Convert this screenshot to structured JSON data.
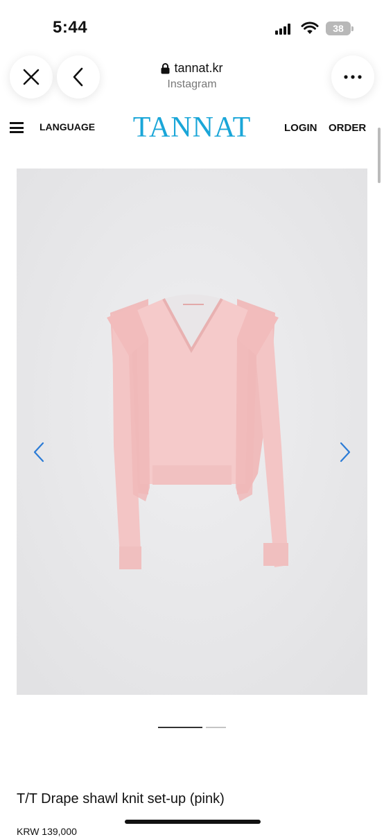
{
  "status_bar": {
    "time": "5:44",
    "battery": "38"
  },
  "browser": {
    "url": "tannat.kr",
    "source": "Instagram"
  },
  "nav": {
    "language": "LANGUAGE",
    "logo": "TANNAT",
    "login": "LOGIN",
    "order": "ORDER"
  },
  "carousel": {
    "current_page": 1,
    "total_pages": 2
  },
  "product": {
    "title": "T/T Drape shawl knit set-up (pink)",
    "price": "KRW 139,000"
  },
  "colors": {
    "brand": "#1aa6d8",
    "arrow": "#2b7bd6",
    "knit": "#f2c4c4"
  }
}
